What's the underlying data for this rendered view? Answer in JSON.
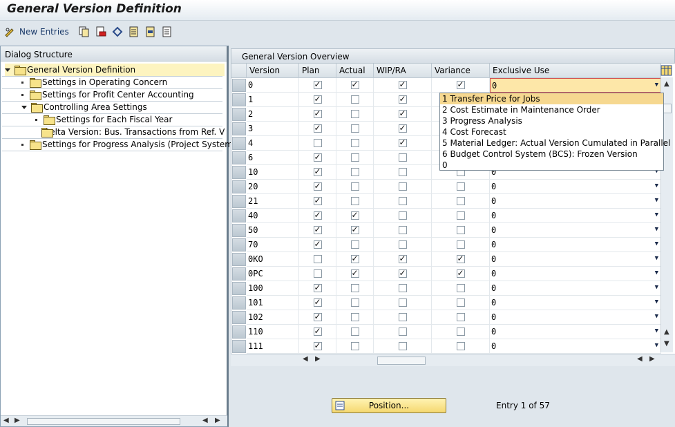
{
  "window": {
    "title": "General Version Definition"
  },
  "toolbar": {
    "new_entries_label": "New Entries"
  },
  "dialog_structure": {
    "header": "Dialog Structure",
    "items": [
      {
        "label": "General Version Definition",
        "level": 0
      },
      {
        "label": "Settings in Operating Concern",
        "level": 1
      },
      {
        "label": "Settings for Profit Center Accounting",
        "level": 1
      },
      {
        "label": "Controlling Area Settings",
        "level": 1
      },
      {
        "label": "Settings for Each Fiscal Year",
        "level": 2
      },
      {
        "label": "Delta Version: Bus. Transactions from Ref. V",
        "level": 2
      },
      {
        "label": "Settings for Progress Analysis (Project System)",
        "level": 1
      }
    ]
  },
  "overview": {
    "header": "General Version Overview",
    "columns": [
      "Version",
      "Plan",
      "Actual",
      "WIP/RA",
      "Variance",
      "Exclusive Use"
    ],
    "rows": [
      {
        "version": "0",
        "plan": true,
        "actual": true,
        "wip": true,
        "variance": true,
        "excl": "0"
      },
      {
        "version": "1",
        "plan": true,
        "actual": false,
        "wip": true,
        "variance": false,
        "excl": "0"
      },
      {
        "version": "2",
        "plan": true,
        "actual": false,
        "wip": true,
        "variance": false,
        "excl": "0"
      },
      {
        "version": "3",
        "plan": true,
        "actual": false,
        "wip": true,
        "variance": false,
        "excl": "0"
      },
      {
        "version": "4",
        "plan": false,
        "actual": false,
        "wip": true,
        "variance": false,
        "excl": "0"
      },
      {
        "version": "6",
        "plan": true,
        "actual": false,
        "wip": false,
        "variance": false,
        "excl": "0"
      },
      {
        "version": "10",
        "plan": true,
        "actual": false,
        "wip": false,
        "variance": false,
        "excl": "0"
      },
      {
        "version": "20",
        "plan": true,
        "actual": false,
        "wip": false,
        "variance": false,
        "excl": "0"
      },
      {
        "version": "21",
        "plan": true,
        "actual": false,
        "wip": false,
        "variance": false,
        "excl": "0"
      },
      {
        "version": "40",
        "plan": true,
        "actual": true,
        "wip": false,
        "variance": false,
        "excl": "0"
      },
      {
        "version": "50",
        "plan": true,
        "actual": true,
        "wip": false,
        "variance": false,
        "excl": "0"
      },
      {
        "version": "70",
        "plan": true,
        "actual": false,
        "wip": false,
        "variance": false,
        "excl": "0"
      },
      {
        "version": "0KO",
        "plan": false,
        "actual": true,
        "wip": true,
        "variance": true,
        "excl": "0"
      },
      {
        "version": "0PC",
        "plan": false,
        "actual": true,
        "wip": true,
        "variance": true,
        "excl": "0"
      },
      {
        "version": "100",
        "plan": true,
        "actual": false,
        "wip": false,
        "variance": false,
        "excl": "0"
      },
      {
        "version": "101",
        "plan": true,
        "actual": false,
        "wip": false,
        "variance": false,
        "excl": "0"
      },
      {
        "version": "102",
        "plan": true,
        "actual": false,
        "wip": false,
        "variance": false,
        "excl": "0"
      },
      {
        "version": "110",
        "plan": true,
        "actual": false,
        "wip": false,
        "variance": false,
        "excl": "0"
      },
      {
        "version": "111",
        "plan": true,
        "actual": false,
        "wip": false,
        "variance": false,
        "excl": "0"
      }
    ],
    "dropdown_options": [
      "1 Transfer Price for Jobs",
      "2 Cost Estimate in Maintenance Order",
      "3 Progress Analysis",
      "4 Cost Forecast",
      "5 Material Ledger: Actual Version Cumulated in Parallel",
      "6 Budget Control System (BCS): Frozen Version",
      "0"
    ],
    "dropdown_selected": 0
  },
  "footer": {
    "position_button": "Position...",
    "entry_text": "Entry 1 of 57"
  },
  "colors": {
    "selection": "#fdf4c0",
    "dropdown_highlight": "#f6d890",
    "background": "#dfe6ec"
  }
}
